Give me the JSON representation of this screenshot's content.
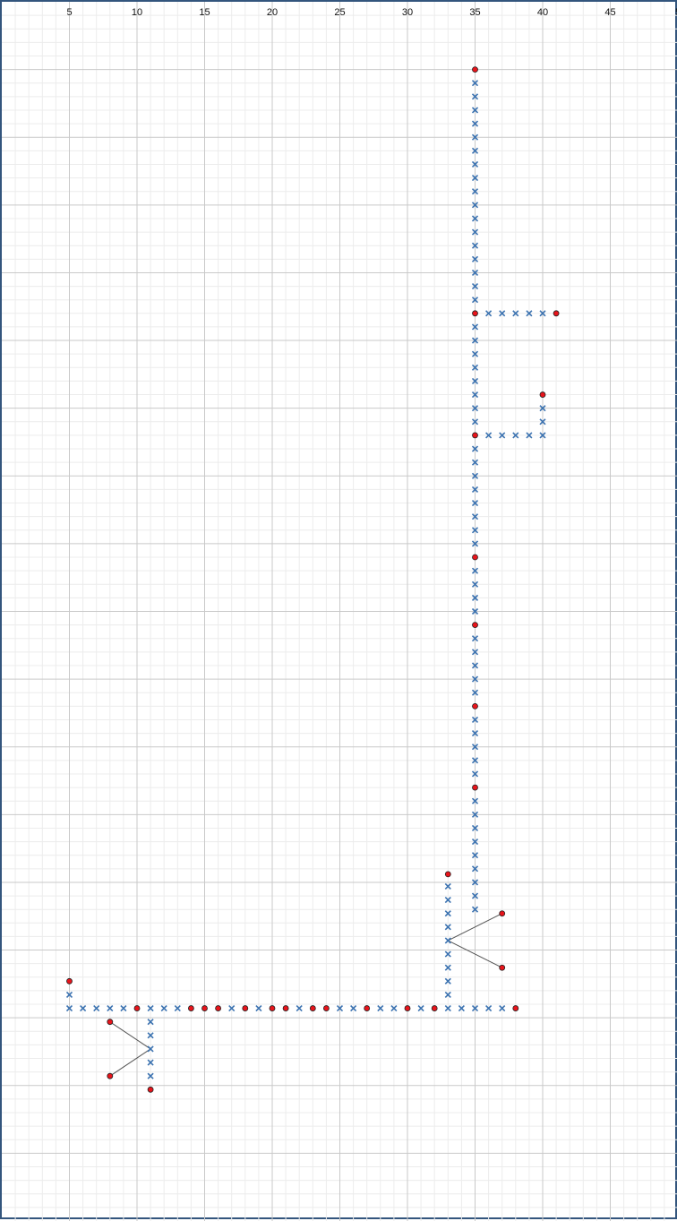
{
  "chart_data": {
    "type": "scatter",
    "title": "",
    "xlabel": "",
    "ylabel": "",
    "grid": true,
    "xlim": [
      0,
      50
    ],
    "ylim": [
      0,
      90
    ],
    "x_ticks": [
      5,
      10,
      15,
      20,
      25,
      30,
      35,
      40,
      45,
      50
    ],
    "x_tick_labels": [
      "5",
      "10",
      "15",
      "20",
      "25",
      "30",
      "35",
      "40",
      "45",
      "5"
    ],
    "y_ticks": [
      5,
      10,
      15,
      20,
      25,
      30,
      35,
      40,
      45,
      50,
      55,
      60,
      65,
      70,
      75,
      80,
      85
    ],
    "marker_colors": {
      "circle": "#e8141b",
      "cross": "#3b72b0",
      "line": "#555555"
    },
    "circle_points": [
      [
        35,
        5
      ],
      [
        35,
        23
      ],
      [
        41,
        23
      ],
      [
        40,
        29
      ],
      [
        35,
        32
      ],
      [
        35,
        41
      ],
      [
        35,
        46
      ],
      [
        35,
        52
      ],
      [
        35,
        58
      ],
      [
        33,
        64.4
      ],
      [
        37,
        67.3
      ],
      [
        37,
        71.3
      ],
      [
        5,
        72.3
      ],
      [
        10,
        74.3
      ],
      [
        14,
        74.3
      ],
      [
        15,
        74.3
      ],
      [
        16,
        74.3
      ],
      [
        18,
        74.3
      ],
      [
        20,
        74.3
      ],
      [
        21,
        74.3
      ],
      [
        23,
        74.3
      ],
      [
        24,
        74.3
      ],
      [
        27,
        74.3
      ],
      [
        30,
        74.3
      ],
      [
        32,
        74.3
      ],
      [
        38,
        74.3
      ],
      [
        8,
        75.3
      ],
      [
        8,
        79.3
      ],
      [
        11,
        80.3
      ]
    ],
    "cross_points": [
      [
        35,
        6
      ],
      [
        35,
        7
      ],
      [
        35,
        8
      ],
      [
        35,
        9
      ],
      [
        35,
        10
      ],
      [
        35,
        11
      ],
      [
        35,
        12
      ],
      [
        35,
        13
      ],
      [
        35,
        14
      ],
      [
        35,
        15
      ],
      [
        35,
        16
      ],
      [
        35,
        17
      ],
      [
        35,
        18
      ],
      [
        35,
        19
      ],
      [
        35,
        20
      ],
      [
        35,
        21
      ],
      [
        35,
        22
      ],
      [
        36,
        23
      ],
      [
        37,
        23
      ],
      [
        38,
        23
      ],
      [
        39,
        23
      ],
      [
        40,
        23
      ],
      [
        35,
        24
      ],
      [
        35,
        25
      ],
      [
        35,
        26
      ],
      [
        35,
        27
      ],
      [
        35,
        28
      ],
      [
        35,
        29
      ],
      [
        35,
        30
      ],
      [
        35,
        31
      ],
      [
        40,
        30
      ],
      [
        40,
        31
      ],
      [
        36,
        32
      ],
      [
        37,
        32
      ],
      [
        38,
        32
      ],
      [
        39,
        32
      ],
      [
        40,
        32
      ],
      [
        35,
        33
      ],
      [
        35,
        34
      ],
      [
        35,
        35
      ],
      [
        35,
        36
      ],
      [
        35,
        37
      ],
      [
        35,
        38
      ],
      [
        35,
        39
      ],
      [
        35,
        40
      ],
      [
        35,
        42
      ],
      [
        35,
        43
      ],
      [
        35,
        44
      ],
      [
        35,
        45
      ],
      [
        35,
        47
      ],
      [
        35,
        48
      ],
      [
        35,
        49
      ],
      [
        35,
        50
      ],
      [
        35,
        51
      ],
      [
        35,
        53
      ],
      [
        35,
        54
      ],
      [
        35,
        55
      ],
      [
        35,
        56
      ],
      [
        35,
        57
      ],
      [
        35,
        59
      ],
      [
        35,
        60
      ],
      [
        35,
        61
      ],
      [
        35,
        62
      ],
      [
        35,
        63
      ],
      [
        35,
        64
      ],
      [
        35,
        65
      ],
      [
        35,
        66
      ],
      [
        35,
        67
      ],
      [
        33,
        65.3
      ],
      [
        33,
        66.3
      ],
      [
        33,
        67.3
      ],
      [
        33,
        68.3
      ],
      [
        33,
        69.3
      ],
      [
        33,
        70.3
      ],
      [
        33,
        71.3
      ],
      [
        33,
        72.3
      ],
      [
        33,
        73.3
      ],
      [
        5,
        73.3
      ],
      [
        5,
        74.3
      ],
      [
        6,
        74.3
      ],
      [
        7,
        74.3
      ],
      [
        8,
        74.3
      ],
      [
        9,
        74.3
      ],
      [
        11,
        74.3
      ],
      [
        12,
        74.3
      ],
      [
        13,
        74.3
      ],
      [
        17,
        74.3
      ],
      [
        19,
        74.3
      ],
      [
        22,
        74.3
      ],
      [
        25,
        74.3
      ],
      [
        26,
        74.3
      ],
      [
        28,
        74.3
      ],
      [
        29,
        74.3
      ],
      [
        31,
        74.3
      ],
      [
        33,
        74.3
      ],
      [
        34,
        74.3
      ],
      [
        35,
        74.3
      ],
      [
        36,
        74.3
      ],
      [
        37,
        74.3
      ],
      [
        11,
        75.3
      ],
      [
        11,
        76.3
      ],
      [
        11,
        77.3
      ],
      [
        11,
        78.3
      ],
      [
        11,
        79.3
      ]
    ],
    "line_segments": [
      [
        [
          33,
          69.3
        ],
        [
          37,
          67.3
        ]
      ],
      [
        [
          33,
          69.3
        ],
        [
          37,
          71.3
        ]
      ],
      [
        [
          11,
          77.3
        ],
        [
          8,
          75.3
        ]
      ],
      [
        [
          11,
          77.3
        ],
        [
          8,
          79.3
        ]
      ]
    ]
  }
}
